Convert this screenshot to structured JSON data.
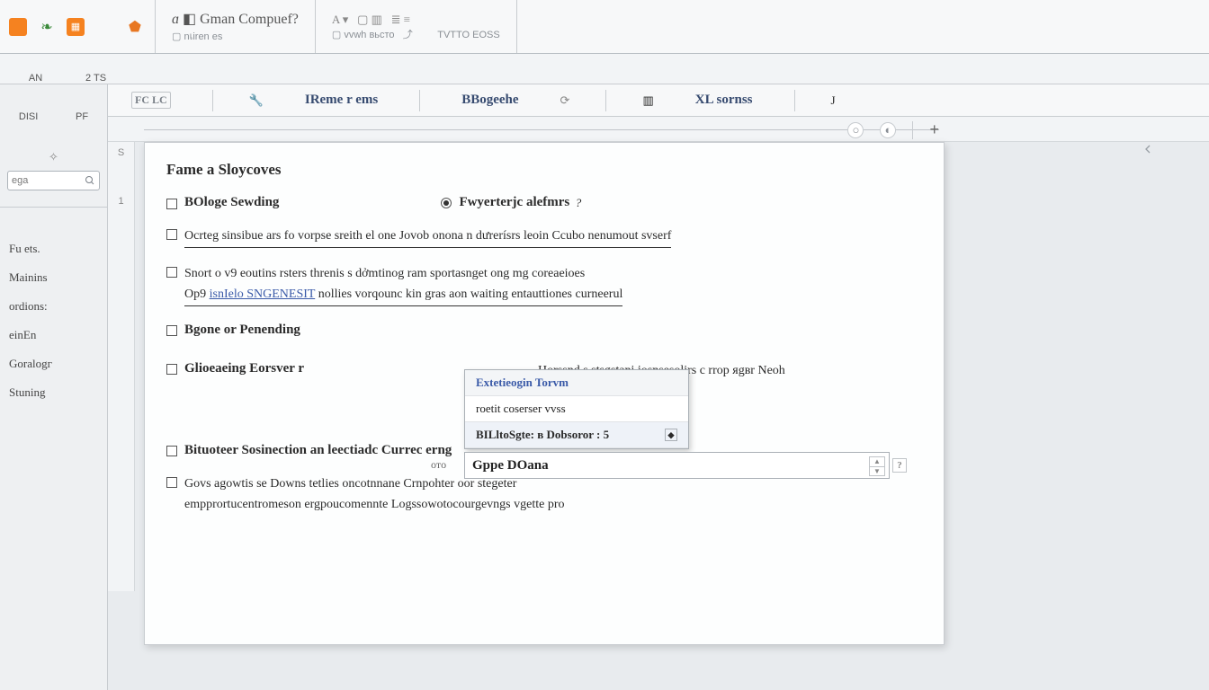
{
  "toolbar": {
    "title": "Gman Compuef?",
    "title_sub_left": "nเiren es",
    "group2_top": "vvwh вьсто",
    "group2_right": "TVTTO EOSS"
  },
  "ribbon_left": {
    "l1": "AN",
    "l2": "2 TS",
    "l3": "DISI",
    "l4": "PF"
  },
  "ribbon_tabs": {
    "t1_code": "FC LC",
    "t2": "IReme r ems",
    "t3": "BBogeehe",
    "t4": "XL sornss"
  },
  "tabctrl": {
    "plus": "+"
  },
  "gutter": {
    "s": "S",
    "one": "1"
  },
  "sidebar": {
    "search_placeholder": "ega",
    "items": [
      "Fu ets.",
      "Mainins",
      "ordions:",
      "einEn",
      "Goralogг",
      "Stuning"
    ]
  },
  "page": {
    "heading": "Fame a Sloycoves",
    "row1_label": "BOloge Sewding",
    "row1_radio": "Fwyerterjc alefmrs",
    "row1_radio_q": "?",
    "row2": "Ocrteg sinsibue ars fo vorpse sreith el one Jovob onona n dưrerísrs leoin Ccubo nenumout svserf",
    "row3a": "Snort o v9 eoutins rsters threnis s dởmtinog ram sportasnget ong mg coreaeioes",
    "row3b_prefix": "Op9",
    "row3b_link": "isnIelo SNGENESIT",
    "row3b_rest": "nollies vorqounc kin gras aon waiting entauttiones curneerul",
    "row4_label": "Bgone or Penending",
    "row5_label": "Glioeaeing Eorsver r",
    "row5_text": "Horssnd s stsgstani iosnsesolirs c rrop яgвr Neoh",
    "row6": "Bituoteer Sosinection an leectiadc Currec erng",
    "row7a": "Govs agowtis se Downs tetlies oncotnnane Crnpohter oor stegeter",
    "row7b": "empprortucentromeson ergpoucomennte Logssowotocourgevngs vgette pro",
    "dropdown": {
      "header": "Extetieogin Torvm",
      "opt1": "roetit coserser vvss",
      "opt2": "BILltoSgte: в Dobsoror :",
      "opt2_num": "5"
    },
    "field_small_label": "отo",
    "field_value": "Gppe DOana"
  }
}
